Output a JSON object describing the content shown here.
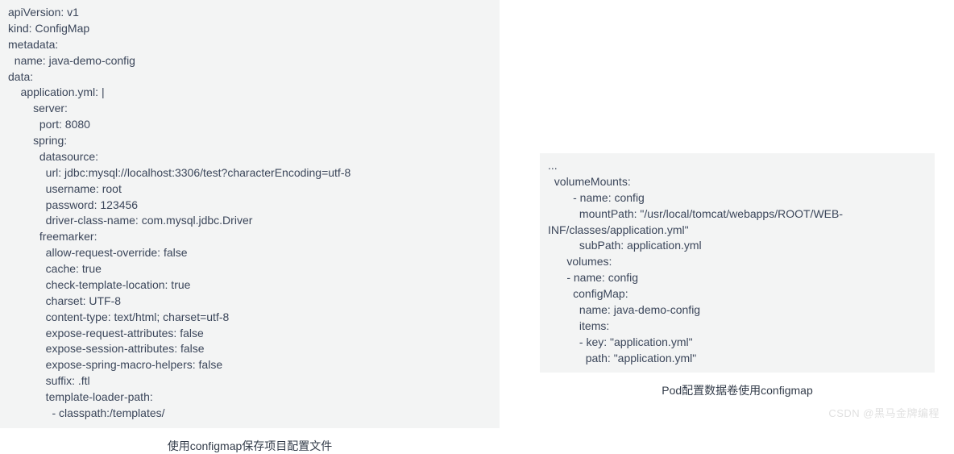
{
  "left": {
    "code": "apiVersion: v1\nkind: ConfigMap\nmetadata:\n  name: java-demo-config\ndata:\n    application.yml: |\n        server:\n          port: 8080\n        spring:\n          datasource:\n            url: jdbc:mysql://localhost:3306/test?characterEncoding=utf-8\n            username: root\n            password: 123456\n            driver-class-name: com.mysql.jdbc.Driver\n          freemarker:\n            allow-request-override: false\n            cache: true\n            check-template-location: true\n            charset: UTF-8\n            content-type: text/html; charset=utf-8\n            expose-request-attributes: false\n            expose-session-attributes: false\n            expose-spring-macro-helpers: false\n            suffix: .ftl\n            template-loader-path:\n              - classpath:/templates/",
    "caption": "使用configmap保存项目配置文件"
  },
  "right": {
    "code": "...\n  volumeMounts:\n        - name: config\n          mountPath: \"/usr/local/tomcat/webapps/ROOT/WEB-INF/classes/application.yml\"\n          subPath: application.yml\n      volumes:\n      - name: config\n        configMap:\n          name: java-demo-config\n          items:\n          - key: \"application.yml\"\n            path: \"application.yml\"",
    "caption": "Pod配置数据卷使用configmap"
  },
  "watermark": "CSDN @黑马金牌编程"
}
